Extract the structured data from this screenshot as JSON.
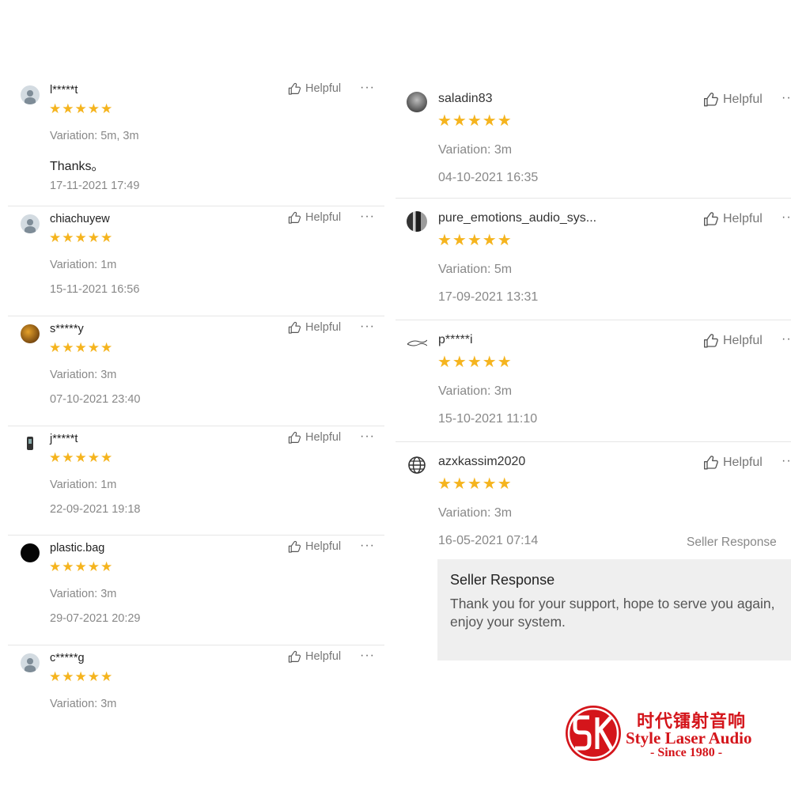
{
  "left_reviews": [
    {
      "avatar": "default-user-avatar",
      "name": "l*****t",
      "stars": "★★★★★",
      "variation": "Variation: 5m, 3m",
      "comment": "Thanks。",
      "date": "17-11-2021 17:49"
    },
    {
      "avatar": "default-user-avatar",
      "name": "chiachuyew",
      "stars": "★★★★★",
      "variation": "Variation: 1m",
      "date": "15-11-2021 16:56"
    },
    {
      "avatar": "photo-avatar",
      "name": "s*****y",
      "stars": "★★★★★",
      "variation": "Variation: 3m",
      "date": "07-10-2021 23:40"
    },
    {
      "avatar": "device-avatar",
      "name": "j*****t",
      "stars": "★★★★★",
      "variation": "Variation: 1m",
      "date": "22-09-2021 19:18"
    },
    {
      "avatar": "black-avatar",
      "name": "plastic.bag",
      "stars": "★★★★★",
      "variation": "Variation: 3m",
      "date": "29-07-2021 20:29"
    },
    {
      "avatar": "default-user-avatar",
      "name": "c*****g",
      "stars": "★★★★★",
      "variation": "Variation: 3m"
    }
  ],
  "right_reviews": [
    {
      "avatar": "photo-avatar",
      "name": "saladin83",
      "stars": "★★★★★",
      "variation": "Variation: 3m",
      "date": "04-10-2021 16:35"
    },
    {
      "avatar": "photo-avatar",
      "name": "pure_emotions_audio_sys...",
      "stars": "★★★★★",
      "variation": "Variation: 5m",
      "date": "17-09-2021 13:31"
    },
    {
      "avatar": "sketch-avatar",
      "name": "p*****i",
      "stars": "★★★★★",
      "variation": "Variation: 3m",
      "date": "15-10-2021 11:10"
    },
    {
      "avatar": "globe-icon",
      "name": "azxkassim2020",
      "stars": "★★★★★",
      "variation": "Variation: 3m",
      "date": "16-05-2021 07:14",
      "seller_link": "Seller Response",
      "seller_response": {
        "title": "Seller Response",
        "text": "Thank you for your support, hope to serve you again, enjoy your system."
      }
    }
  ],
  "ui": {
    "helpful_label": "Helpful",
    "more_label": "···",
    "helpful_icon": "thumbs-up-icon",
    "more_icon": "more-dots-icon",
    "star_color": "#f5b41e"
  },
  "logo": {
    "chinese": "时代镭射音响",
    "english": "Style Laser Audio",
    "since": "- Since 1980 -",
    "brand_color": "#d4151b"
  }
}
